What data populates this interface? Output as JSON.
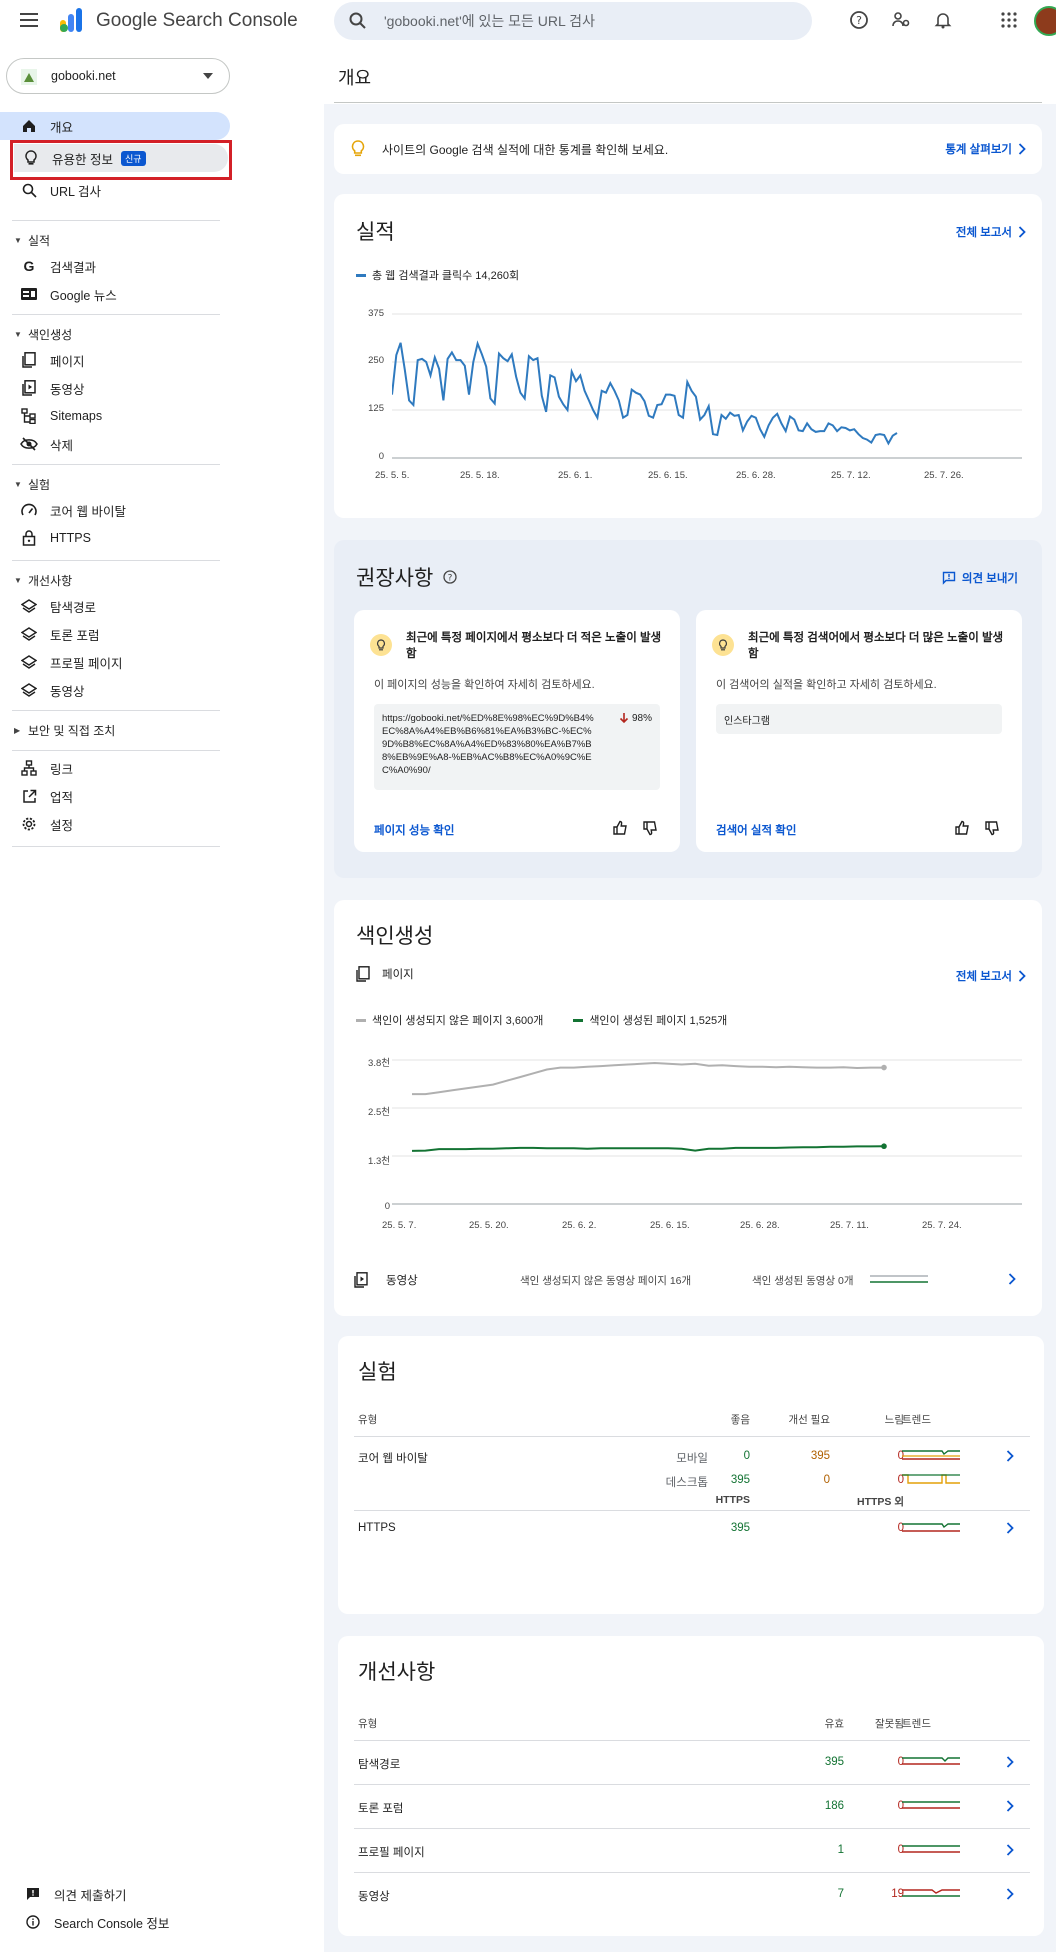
{
  "header": {
    "app_name": "Google Search Console",
    "search_placeholder": "'gobooki.net'에 있는 모든 URL 검사"
  },
  "sidebar": {
    "property": "gobooki.net",
    "items": {
      "overview": "개요",
      "insights": "유용한 정보",
      "insights_badge": "신규",
      "url_inspect": "URL 검사",
      "sec_performance": "실적",
      "search_results": "검색결과",
      "google_news": "Google 뉴스",
      "sec_indexing": "색인생성",
      "pages": "페이지",
      "videos": "동영상",
      "sitemaps": "Sitemaps",
      "removals": "삭제",
      "sec_experience": "실험",
      "cwv": "코어 웹 바이탈",
      "https": "HTTPS",
      "sec_enhancements": "개선사항",
      "breadcrumbs": "탐색경로",
      "forum": "토론 포럼",
      "profile": "프로필 페이지",
      "video_enh": "동영상",
      "sec_security": "보안 및 직접 조치",
      "links": "링크",
      "achievements": "업적",
      "settings": "설정",
      "feedback": "의견 제출하기",
      "about": "Search Console 정보"
    }
  },
  "page_title": "개요",
  "banner": {
    "text": "사이트의 Google 검색 실적에 대한 통계를 확인해 보세요.",
    "link": "통계 살펴보기"
  },
  "performance": {
    "title": "실적",
    "full_report": "전체 보고서",
    "legend": "총 웹 검색결과 클릭수 14,260회",
    "y_ticks": [
      "375",
      "250",
      "125",
      "0"
    ],
    "x_ticks": [
      "25. 5. 5.",
      "25. 5. 18.",
      "25. 6. 1.",
      "25. 6. 15.",
      "25. 6. 28.",
      "25. 7. 12.",
      "25. 7. 26."
    ]
  },
  "recommendations": {
    "title": "권장사항",
    "feedback": "의견 보내기",
    "card1": {
      "title": "최근에 특정 페이지에서 평소보다 더 적은 노출이 발생함",
      "desc": "이 페이지의 성능을 확인하여 자세히 검토하세요.",
      "url": "https://gobooki.net/%ED%8E%98%EC%9D%B4%EC%8A%A4%EB%B6%81%EA%B3%BC-%EC%9D%B8%EC%8A%A4%ED%83%80%EA%B7%B8%EB%9E%A8-%EB%AC%B8%EC%A0%9C%EC%A0%90/",
      "pct": "98%",
      "action": "페이지 성능 확인"
    },
    "card2": {
      "title": "최근에 특정 검색어에서 평소보다 더 많은 노출이 발생함",
      "desc": "이 검색어의 실적을 확인하고 자세히 검토하세요.",
      "query": "인스타그램",
      "action": "검색어 실적 확인"
    }
  },
  "indexing": {
    "title": "색인생성",
    "pages_label": "페이지",
    "full_report": "전체 보고서",
    "legend_not_indexed": "색인이 생성되지 않은 페이지 3,600개",
    "legend_indexed": "색인이 생성된 페이지 1,525개",
    "y_ticks": [
      "3.8천",
      "2.5천",
      "1.3천",
      "0"
    ],
    "x_ticks": [
      "25. 5. 7.",
      "25. 5. 20.",
      "25. 6. 2.",
      "25. 6. 15.",
      "25. 6. 28.",
      "25. 7. 11.",
      "25. 7. 24."
    ],
    "video_label": "동영상",
    "video_not_indexed": "색인 생성되지 않은 동영상 페이지 16개",
    "video_indexed": "색인 생성된 동영상 0개"
  },
  "experience": {
    "title": "실험",
    "col_type": "유형",
    "col_good": "좋음",
    "col_ni": "개선 필요",
    "col_poor": "느림",
    "col_trend": "트렌드",
    "cwv_label": "코어 웹 바이탈",
    "mobile": "모바일",
    "mobile_good": "0",
    "mobile_ni": "395",
    "mobile_poor": "0",
    "desktop": "데스크톱",
    "desktop_good": "395",
    "desktop_ni": "0",
    "desktop_poor": "0",
    "col_https": "HTTPS",
    "col_non_https": "HTTPS 외",
    "https_label": "HTTPS",
    "https_good": "395",
    "https_bad": "0"
  },
  "enhancements": {
    "title": "개선사항",
    "col_type": "유형",
    "col_valid": "유효",
    "col_invalid": "잘못됨",
    "col_trend": "트렌드",
    "rows": [
      {
        "name": "탐색경로",
        "valid": "395",
        "invalid": "0"
      },
      {
        "name": "토론 포럼",
        "valid": "186",
        "invalid": "0"
      },
      {
        "name": "프로필 페이지",
        "valid": "1",
        "invalid": "0"
      },
      {
        "name": "동영상",
        "valid": "7",
        "invalid": "19"
      }
    ]
  },
  "chart_data": [
    {
      "type": "line",
      "title": "실적",
      "series": [
        {
          "name": "총 웹 검색결과 클릭수 14,260회",
          "values": [
            165,
            268,
            300,
            230,
            150,
            138,
            255,
            258,
            250,
            215,
            262,
            232,
            150,
            258,
            275,
            255,
            255,
            240,
            165,
            250,
            298,
            270,
            238,
            155,
            142,
            272,
            260,
            252,
            270,
            212,
            170,
            155,
            265,
            255,
            260,
            162,
            120,
            215,
            210,
            160,
            140,
            125,
            225,
            200,
            215,
            175,
            150,
            125,
            105,
            175,
            170,
            195,
            175,
            150,
            105,
            112,
            178,
            170,
            165,
            148,
            110,
            105,
            138,
            140,
            165,
            165,
            162,
            112,
            105,
            198,
            175,
            160,
            100,
            112,
            135,
            62,
            60,
            112,
            102,
            118,
            110,
            112,
            72,
            95,
            110,
            105,
            75,
            55,
            85,
            105,
            115,
            90,
            70,
            108,
            100,
            72,
            70,
            90,
            75,
            68,
            70,
            70,
            90,
            85,
            70,
            80,
            78,
            72,
            75,
            62,
            52,
            48,
            40,
            60,
            62,
            60,
            38,
            58,
            65
          ]
        }
      ],
      "ylim": [
        0,
        375
      ]
    },
    {
      "type": "line",
      "title": "색인생성",
      "series": [
        {
          "name": "색인이 생성되지 않은 페이지 3,600개",
          "values": [
            2900,
            2900,
            2950,
            3000,
            3050,
            3100,
            3150,
            3250,
            3350,
            3450,
            3550,
            3600,
            3600,
            3620,
            3640,
            3660,
            3680,
            3700,
            3720,
            3700,
            3680,
            3700,
            3650,
            3660,
            3640,
            3620,
            3620,
            3610,
            3620,
            3610,
            3600,
            3600,
            3610,
            3590,
            3600,
            3600
          ]
        },
        {
          "name": "색인이 생성된 페이지 1,525개",
          "values": [
            1400,
            1410,
            1450,
            1450,
            1450,
            1460,
            1460,
            1470,
            1480,
            1480,
            1470,
            1470,
            1470,
            1460,
            1470,
            1470,
            1470,
            1470,
            1470,
            1470,
            1460,
            1410,
            1460,
            1460,
            1480,
            1480,
            1480,
            1480,
            1490,
            1500,
            1500,
            1510,
            1510,
            1520,
            1520,
            1525
          ]
        }
      ],
      "ylim": [
        0,
        3800
      ]
    }
  ]
}
